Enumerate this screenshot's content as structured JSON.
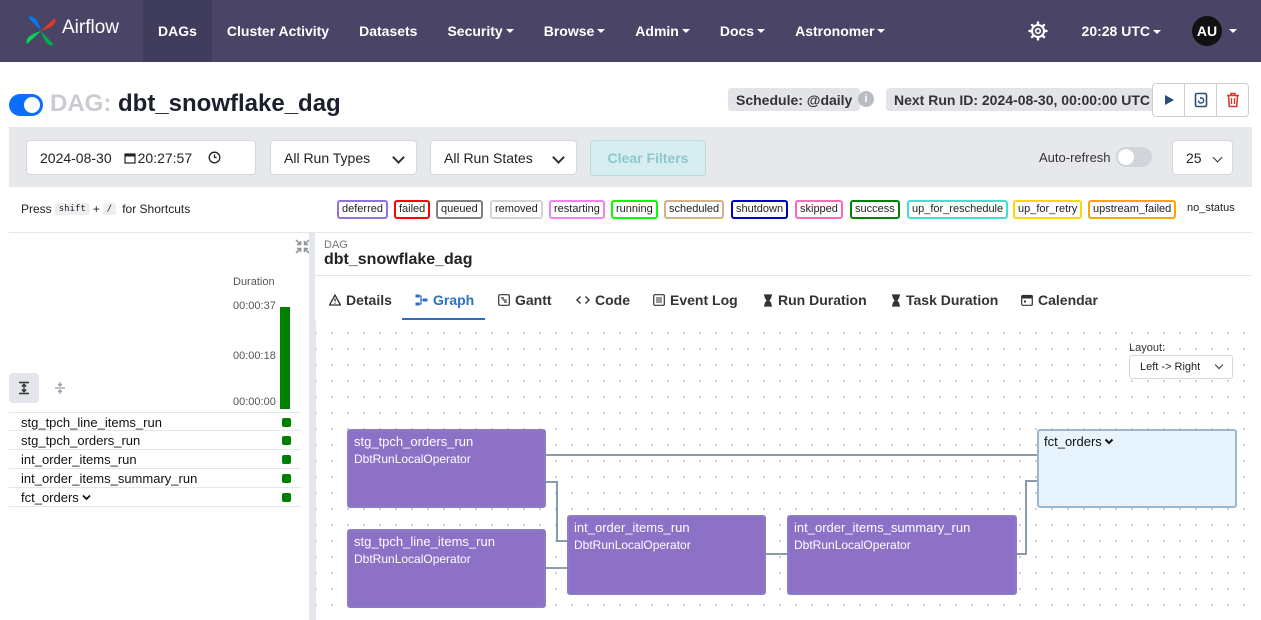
{
  "navbar": {
    "brand": "Airflow",
    "items": [
      {
        "label": "DAGs",
        "active": true,
        "dropdown": false
      },
      {
        "label": "Cluster Activity",
        "dropdown": false
      },
      {
        "label": "Datasets",
        "dropdown": false
      },
      {
        "label": "Security",
        "dropdown": true
      },
      {
        "label": "Browse",
        "dropdown": true
      },
      {
        "label": "Admin",
        "dropdown": true
      },
      {
        "label": "Docs",
        "dropdown": true
      },
      {
        "label": "Astronomer",
        "dropdown": true
      }
    ],
    "time": "20:28 UTC",
    "avatar": "AU"
  },
  "dag": {
    "prefix": "DAG:",
    "name": "dbt_snowflake_dag",
    "schedule": "Schedule: @daily",
    "next_run": "Next Run ID: 2024-08-30, 00:00:00 UTC"
  },
  "filters": {
    "date": "2024-08-30",
    "time": "20:27:57",
    "run_type": "All Run Types",
    "run_state": "All Run States",
    "clear": "Clear Filters",
    "auto_refresh": "Auto-refresh",
    "page_size": "25"
  },
  "shortcuts": {
    "press": "Press",
    "key1": "shift",
    "plus": "+",
    "key2": "/",
    "suffix": "for Shortcuts"
  },
  "legend": [
    {
      "label": "deferred",
      "color": "#9370db"
    },
    {
      "label": "failed",
      "color": "#ff0000"
    },
    {
      "label": "queued",
      "color": "#808080"
    },
    {
      "label": "removed",
      "color": "#d3d3d3"
    },
    {
      "label": "restarting",
      "color": "#ee82ee"
    },
    {
      "label": "running",
      "color": "#00ff00"
    },
    {
      "label": "scheduled",
      "color": "#d2b48c"
    },
    {
      "label": "shutdown",
      "color": "#0000cd"
    },
    {
      "label": "skipped",
      "color": "#ff69b4"
    },
    {
      "label": "success",
      "color": "#008000"
    },
    {
      "label": "up_for_reschedule",
      "color": "#40e0d0"
    },
    {
      "label": "up_for_retry",
      "color": "#ffd700"
    },
    {
      "label": "upstream_failed",
      "color": "#ffa500"
    }
  ],
  "no_status": "no_status",
  "grid": {
    "duration_label": "Duration",
    "ticks": [
      "00:00:37",
      "00:00:18",
      "00:00:00"
    ],
    "tasks": [
      "stg_tpch_line_items_run",
      "stg_tpch_orders_run",
      "int_order_items_run",
      "int_order_items_summary_run",
      "fct_orders"
    ],
    "task_status_color": "#008000"
  },
  "details": {
    "dag_label": "DAG",
    "dag_name": "dbt_snowflake_dag",
    "tabs": [
      "Details",
      "Graph",
      "Gantt",
      "Code",
      "Event Log",
      "Run Duration",
      "Task Duration",
      "Calendar"
    ],
    "active_tab": "Graph"
  },
  "graph": {
    "layout_label": "Layout:",
    "layout_value": "Left -> Right",
    "nodes": [
      {
        "id": "stg_tpch_orders_run",
        "operator": "DbtRunLocalOperator"
      },
      {
        "id": "stg_tpch_line_items_run",
        "operator": "DbtRunLocalOperator"
      },
      {
        "id": "int_order_items_run",
        "operator": "DbtRunLocalOperator"
      },
      {
        "id": "int_order_items_summary_run",
        "operator": "DbtRunLocalOperator"
      }
    ],
    "group": "fct_orders"
  }
}
